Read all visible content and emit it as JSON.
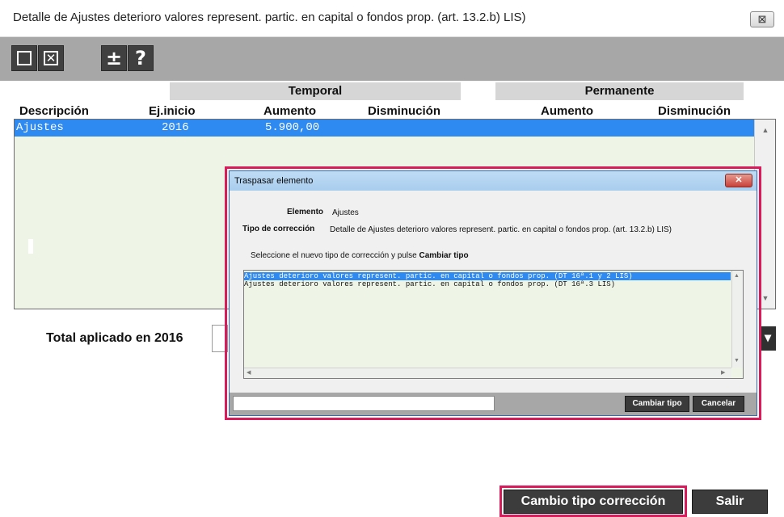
{
  "window": {
    "title": "Detalle de Ajustes deterioro valores represent. partic. en capital o fondos prop. (art. 13.2.b) LIS)",
    "close_icon": "⊠"
  },
  "toolbar": {
    "buttons": [
      {
        "name": "new-icon",
        "glyph": ""
      },
      {
        "name": "delete-icon",
        "glyph": "✕"
      },
      {
        "name": "plus-minus-icon",
        "glyph": "±"
      },
      {
        "name": "help-icon",
        "glyph": "?"
      }
    ]
  },
  "grid": {
    "group_headers": {
      "temporal": "Temporal",
      "permanente": "Permanente"
    },
    "columns": [
      "Descripción",
      "Ej.inicio",
      "Aumento",
      "Disminución",
      "Aumento",
      "Disminución"
    ],
    "rows": [
      {
        "descripcion": "Ajustes",
        "ej_inicio": "2016",
        "temp_aumento": "5.900,00",
        "temp_disminucion": "",
        "perm_aumento": "",
        "perm_disminucion": ""
      }
    ],
    "scroll_up": "▲",
    "scroll_down": "▼"
  },
  "total": {
    "label": "Total aplicado en 2016",
    "value": ""
  },
  "dialog": {
    "title": "Traspasar elemento",
    "close_icon": "✕",
    "elemento_label": "Elemento",
    "elemento_value": "Ajustes",
    "tipo_label": "Tipo de corrección",
    "tipo_value": "Detalle de Ajustes deterioro valores represent. partic. en capital o fondos prop. (art. 13.2.b) LIS)",
    "instruction_prefix": "Seleccione el nuevo tipo de corrección y pulse",
    "instruction_bold": "Cambiar tipo",
    "options": [
      "Ajustes deterioro valores represent. partic. en capital o fondos prop. (DT 16ª.1 y 2 LIS)",
      "Ajustes deterioro valores represent. partic. en capital o fondos prop. (DT 16ª.3 LIS)"
    ],
    "selected_index": 0,
    "input_value": "",
    "cambiar_button": "Cambiar tipo",
    "cancelar_button": "Cancelar",
    "scroll_up": "▲",
    "scroll_down": "▼",
    "scroll_left": "◀",
    "scroll_right": "▶"
  },
  "footer": {
    "cambio_button": "Cambio tipo corrección",
    "salir_button": "Salir"
  },
  "colors": {
    "selection": "#2e8af0",
    "grid_background": "#eef4e6",
    "toolbar": "#a7a7a7",
    "highlight": "#d81b5a"
  }
}
